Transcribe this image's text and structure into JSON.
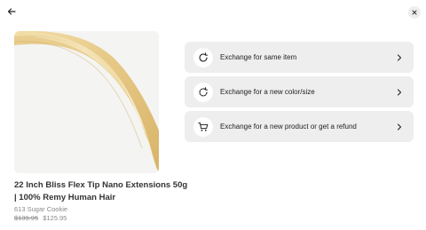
{
  "icons": {
    "back": "arrow-left-icon",
    "close": "close-icon",
    "same_item": "refresh-icon",
    "new_color": "refresh-dashed-icon",
    "new_product": "shopping-cart-icon",
    "chevron": "chevron-right-icon"
  },
  "product": {
    "title": "22 Inch Bliss Flex Tip Nano Extensions 50g | 100% Remy Human Hair",
    "variant": "613 Sugar Cookie",
    "original_price": "$139.95",
    "sale_price": "$125.95"
  },
  "options": [
    {
      "label": "Exchange for same item"
    },
    {
      "label": "Exchange for a new color/size"
    },
    {
      "label": "Exchange for a new product or get a refund"
    }
  ],
  "colors": {
    "option_bg": "#eeeeee",
    "hair": "#e9cf93"
  }
}
